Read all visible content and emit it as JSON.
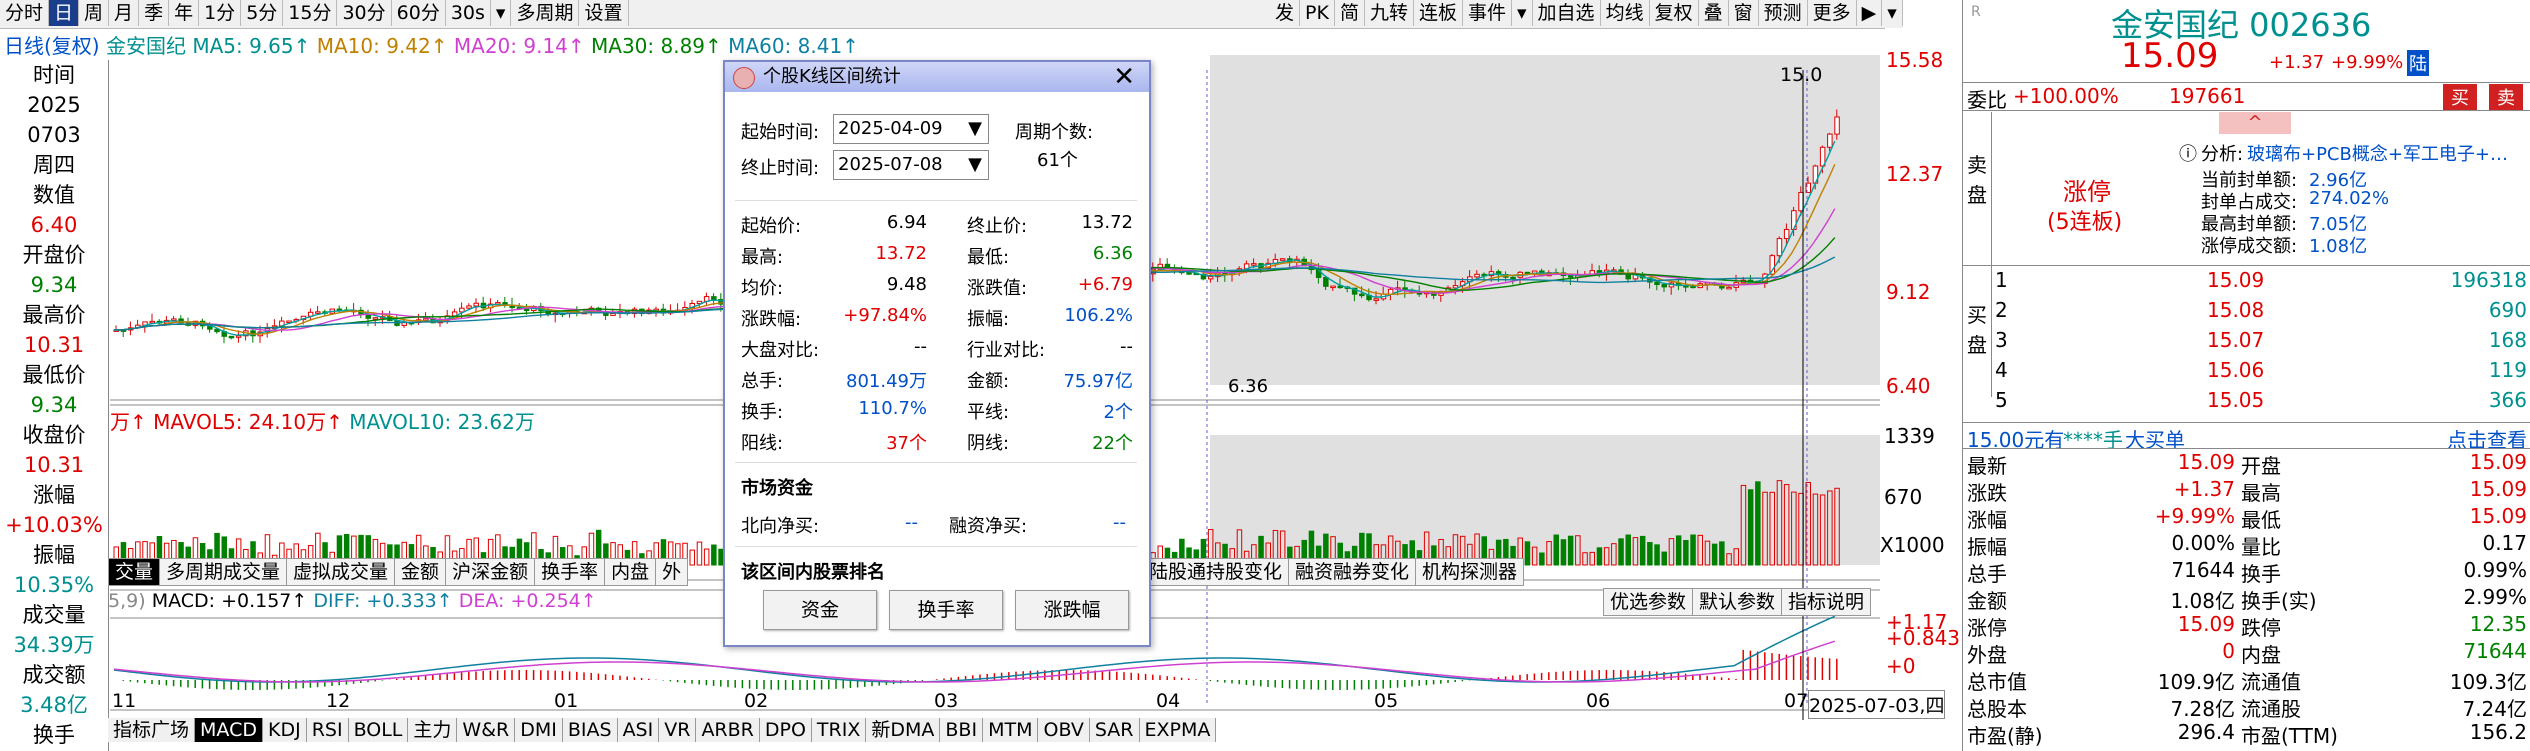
{
  "toolbar": {
    "items": [
      "分时",
      "日",
      "周",
      "月",
      "季",
      "年",
      "1分",
      "5分",
      "15分",
      "30分",
      "60分",
      "30s",
      "▾",
      "多周期",
      "设置"
    ],
    "right_items": [
      "发",
      "PK",
      "简",
      "九转",
      "连板",
      "事件",
      "▾",
      "加自选",
      "均线",
      "复权",
      "叠",
      "窗",
      "预测",
      "更多",
      "▶",
      "▾"
    ]
  },
  "ma_legend": {
    "period": "日线(复权)",
    "name": "金安国纪",
    "ma5": "MA5: 9.65↑",
    "ma10": "MA10: 9.42↑",
    "ma20": "MA20: 9.14↑",
    "ma30": "MA30: 8.89↑",
    "ma60": "MA60: 8.41↑"
  },
  "left_panel": [
    {
      "label": "时间",
      "value": "2025",
      "cls": ""
    },
    {
      "label": "",
      "value": "0703",
      "cls": ""
    },
    {
      "label": "",
      "value": "周四",
      "cls": ""
    },
    {
      "label": "数值",
      "value": "6.40",
      "cls": "red"
    },
    {
      "label": "开盘价",
      "value": "9.34",
      "cls": "green"
    },
    {
      "label": "最高价",
      "value": "10.31",
      "cls": "red"
    },
    {
      "label": "最低价",
      "value": "9.34",
      "cls": "green"
    },
    {
      "label": "收盘价",
      "value": "10.31",
      "cls": "red"
    },
    {
      "label": "涨幅",
      "value": "+10.03%",
      "cls": "red"
    },
    {
      "label": "振幅",
      "value": "10.35%",
      "cls": "teal"
    },
    {
      "label": "成交量",
      "value": "34.39万",
      "cls": "teal"
    },
    {
      "label": "成交额",
      "value": "3.48亿",
      "cls": "teal"
    },
    {
      "label": "换手",
      "value": "",
      "cls": ""
    }
  ],
  "price_axis": [
    "15.58",
    "12.37",
    "9.12",
    "6.40"
  ],
  "price_label_top": "15.0",
  "low_label": "6.36",
  "vol_legend": {
    "mavol5": "万↑ MAVOL5: 24.10万↑",
    "mavol10": "MAVOL10: 23.62万"
  },
  "vol_axis": [
    "1339",
    "670",
    "X1000"
  ],
  "mid_tabs": [
    "交量",
    "多周期成交量",
    "虚拟成交量",
    "金额",
    "沪深金额",
    "换手率",
    "内盘",
    "外"
  ],
  "mid_tabs_right": [
    "陆股通持股变化",
    "融资融券变化",
    "机构探测器"
  ],
  "macd_legend": {
    "params": "5,9)",
    "macd": "MACD: +0.157↑",
    "diff": "DIFF: +0.333↑",
    "dea": "DEA: +0.254↑"
  },
  "macd_buttons": [
    "优选参数",
    "默认参数",
    "指标说明"
  ],
  "macd_axis": [
    "+1.17",
    "+0.843",
    "+0"
  ],
  "x_axis": [
    "11",
    "12",
    "01",
    "02",
    "03",
    "04",
    "05",
    "06",
    "07"
  ],
  "x_date_label": "2025-07-03,四",
  "bottom_tabs": [
    "指标广场",
    "MACD",
    "KDJ",
    "RSI",
    "BOLL",
    "主力",
    "W&R",
    "DMI",
    "BIAS",
    "ASI",
    "VR",
    "ARBR",
    "DPO",
    "TRIX",
    "新DMA",
    "BBI",
    "MTM",
    "OBV",
    "SAR",
    "EXPMA"
  ],
  "popup": {
    "title": "个股K线区间统计",
    "start_label": "起始时间:",
    "start_value": "2025-04-09",
    "end_label": "终止时间:",
    "end_value": "2025-07-08",
    "count_label": "周期个数:",
    "count_value": "61个",
    "rows": [
      {
        "l1": "起始价:",
        "v1": "6.94",
        "c1": "",
        "l2": "终止价:",
        "v2": "13.72",
        "c2": ""
      },
      {
        "l1": "最高:",
        "v1": "13.72",
        "c1": "red",
        "l2": "最低:",
        "v2": "6.36",
        "c2": "green"
      },
      {
        "l1": "均价:",
        "v1": "9.48",
        "c1": "",
        "l2": "涨跌值:",
        "v2": "+6.79",
        "c2": "red"
      },
      {
        "l1": "涨跌幅:",
        "v1": "+97.84%",
        "c1": "red",
        "l2": "振幅:",
        "v2": "106.2%",
        "c2": "blue"
      },
      {
        "l1": "大盘对比:",
        "v1": "--",
        "c1": "",
        "l2": "行业对比:",
        "v2": "--",
        "c2": ""
      },
      {
        "l1": "总手:",
        "v1": "801.49万",
        "c1": "blue",
        "l2": "金额:",
        "v2": "75.97亿",
        "c2": "blue"
      },
      {
        "l1": "换手:",
        "v1": "110.7%",
        "c1": "blue",
        "l2": "平线:",
        "v2": "2个",
        "c2": "blue"
      },
      {
        "l1": "阳线:",
        "v1": "37个",
        "c1": "red",
        "l2": "阴线:",
        "v2": "22个",
        "c2": "green"
      }
    ],
    "fund_title": "市场资金",
    "north_label": "北向净买:",
    "north_value": "--",
    "margin_label": "融资净买:",
    "margin_value": "--",
    "rank_title": "该区间内股票排名",
    "buttons": [
      "资金",
      "换手率",
      "涨跌幅"
    ]
  },
  "stock": {
    "name": "金安国纪 002636",
    "price": "15.09",
    "change": "+1.37",
    "pct": "+9.99%",
    "tag": "陆"
  },
  "weibi": {
    "label": "委比",
    "pct": "+100.00%",
    "value": "197661",
    "buy": "买",
    "sell": "卖"
  },
  "sell_label": "卖盘",
  "limit": {
    "text": "涨停",
    "sub": "(5连板)"
  },
  "analysis": {
    "label": "分析:",
    "value": "玻璃布+PCB概念+军工电子+…",
    "rows": [
      [
        "当前封单额:",
        "2.96亿"
      ],
      [
        "封单占成交:",
        "274.02%"
      ],
      [
        "最高封单额:",
        "7.05亿"
      ],
      [
        "涨停成交额:",
        "1.08亿"
      ]
    ]
  },
  "buy_label": "买盘",
  "bids": [
    [
      "1",
      "15.09",
      "196318"
    ],
    [
      "2",
      "15.08",
      "690"
    ],
    [
      "3",
      "15.07",
      "168"
    ],
    [
      "4",
      "15.06",
      "119"
    ],
    [
      "5",
      "15.05",
      "366"
    ]
  ],
  "bigorder": {
    "price": "15.00元有",
    "mask": "****手",
    "text": "大买单",
    "link": "点击查看"
  },
  "quote": [
    [
      "最新",
      "15.09",
      "red",
      "开盘",
      "15.09",
      "red"
    ],
    [
      "涨跌",
      "+1.37",
      "red",
      "最高",
      "15.09",
      "red"
    ],
    [
      "涨幅",
      "+9.99%",
      "red",
      "最低",
      "15.09",
      "red"
    ],
    [
      "振幅",
      "0.00%",
      "",
      "量比",
      "0.17",
      ""
    ],
    [
      "总手",
      "71644",
      "",
      "换手",
      "0.99%",
      ""
    ],
    [
      "金额",
      "1.08亿",
      "",
      "换手(实)",
      "2.99%",
      ""
    ],
    [
      "涨停",
      "15.09",
      "red",
      "跌停",
      "12.35",
      "green"
    ],
    [
      "外盘",
      "0",
      "red",
      "内盘",
      "71644",
      "green"
    ],
    [
      "总市值",
      "109.9亿",
      "",
      "流通值",
      "109.3亿",
      ""
    ],
    [
      "总股本",
      "7.28亿",
      "",
      "流通股",
      "7.24亿",
      ""
    ],
    [
      "市盈(静)",
      "296.4",
      "",
      "市盈(TTM)",
      "156.2",
      ""
    ]
  ]
}
